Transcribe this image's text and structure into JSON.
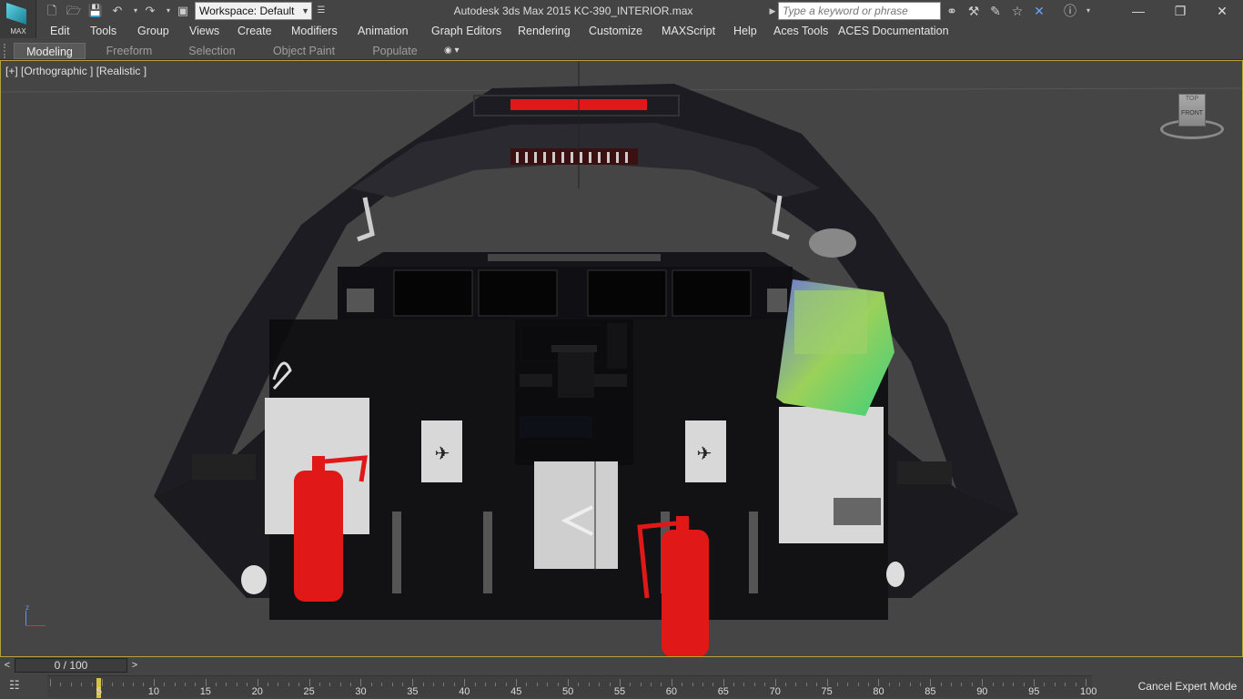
{
  "app": {
    "logo_label": "MAX",
    "title": "Autodesk 3ds Max  2015     KC-390_INTERIOR.max",
    "workspace": "Workspace: Default",
    "search_placeholder": "Type a keyword or phrase"
  },
  "menu": [
    "Edit",
    "Tools",
    "Group",
    "Views",
    "Create",
    "Modifiers",
    "Animation",
    "Graph Editors",
    "Rendering",
    "Customize",
    "MAXScript",
    "Help",
    "Aces Tools",
    "ACES Documentation"
  ],
  "ribbon": {
    "tabs": [
      "Modeling",
      "Freeform",
      "Selection",
      "Object Paint",
      "Populate"
    ],
    "active": "Modeling"
  },
  "viewport": {
    "label": "[+] [Orthographic ] [Realistic ]",
    "viewcube_face": "FRONT",
    "viewcube_top": "TOP"
  },
  "timeline": {
    "frame_display": "0 / 100",
    "prev": "<",
    "next": ">",
    "ticks": [
      5,
      10,
      15,
      20,
      25,
      30,
      35,
      40,
      45,
      50,
      55,
      60,
      65,
      70,
      75,
      80,
      85,
      90,
      95,
      100
    ],
    "cancel_expert_label": "Cancel Expert Mode"
  },
  "colors": {
    "viewport_border": "#b5a33a",
    "extinguisher": "#e01818",
    "panel_gradient_start": "#9bd15a",
    "panel_gradient_end": "#6c78d8"
  },
  "icons": {
    "new": "new-file-icon",
    "open": "open-file-icon",
    "save": "save-icon",
    "undo": "undo-icon",
    "redo": "redo-icon",
    "project": "project-folder-icon",
    "binoculars": "binoculars-icon",
    "subscription": "subscription-icon",
    "communication": "communication-icon",
    "favorites": "star-icon",
    "exchange": "exchange-icon",
    "help": "help-icon"
  }
}
